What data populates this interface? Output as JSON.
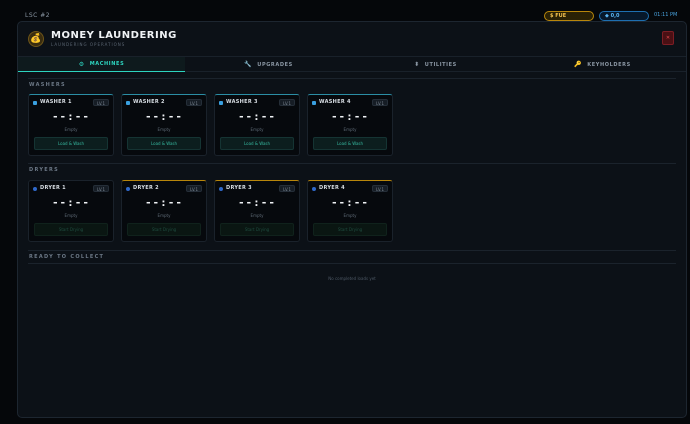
{
  "topbar": {
    "location": "LSC #2",
    "cash": "$ FUE $26,586",
    "crypto": "◆ 0,0 511,999",
    "time": "01:11 PM"
  },
  "header": {
    "logo_glyph": "💰",
    "title": "MONEY LAUNDERING",
    "subtitle": "LAUNDERING OPERATIONS",
    "close_label": "✕"
  },
  "tabs": [
    {
      "label": "MACHINES",
      "icon": "⚙",
      "icon_name": "gear-icon",
      "active": true
    },
    {
      "label": "UPGRADES",
      "icon": "🔧",
      "icon_name": "wrench-icon",
      "active": false
    },
    {
      "label": "UTILITIES",
      "icon": "⬍",
      "icon_name": "plug-icon",
      "active": false
    },
    {
      "label": "KEYHOLDERS",
      "icon": "🔑",
      "icon_name": "key-icon",
      "active": false
    }
  ],
  "sections": {
    "washers": "WASHERS",
    "dryers": "DRYERS",
    "ready": "READY TO COLLECT"
  },
  "washers": [
    {
      "name": "WASHER 1",
      "level": "LV.1",
      "timer": "--:--",
      "status": "Empty",
      "button": "Load & Wash"
    },
    {
      "name": "WASHER 2",
      "level": "LV.1",
      "timer": "--:--",
      "status": "Empty",
      "button": "Load & Wash"
    },
    {
      "name": "WASHER 3",
      "level": "LV.1",
      "timer": "--:--",
      "status": "Empty",
      "button": "Load & Wash"
    },
    {
      "name": "WASHER 4",
      "level": "LV.1",
      "timer": "--:--",
      "status": "Empty",
      "button": "Load & Wash"
    }
  ],
  "dryers": [
    {
      "name": "DRYER 1",
      "level": "LV.1",
      "timer": "--:--",
      "status": "Empty",
      "button": "Start Drying"
    },
    {
      "name": "DRYER 2",
      "level": "LV.1",
      "timer": "--:--",
      "status": "Empty",
      "button": "Start Drying"
    },
    {
      "name": "DRYER 3",
      "level": "LV.1",
      "timer": "--:--",
      "status": "Empty",
      "button": "Start Drying"
    },
    {
      "name": "DRYER 4",
      "level": "LV.1",
      "timer": "--:--",
      "status": "Empty",
      "button": "Start Drying"
    }
  ],
  "ready": {
    "empty_message": "No completed loads yet"
  },
  "colors": {
    "accent": "#2dd4bf",
    "cash": "#f2c14e",
    "crypto": "#5ab4f0",
    "danger": "#e5484d"
  }
}
